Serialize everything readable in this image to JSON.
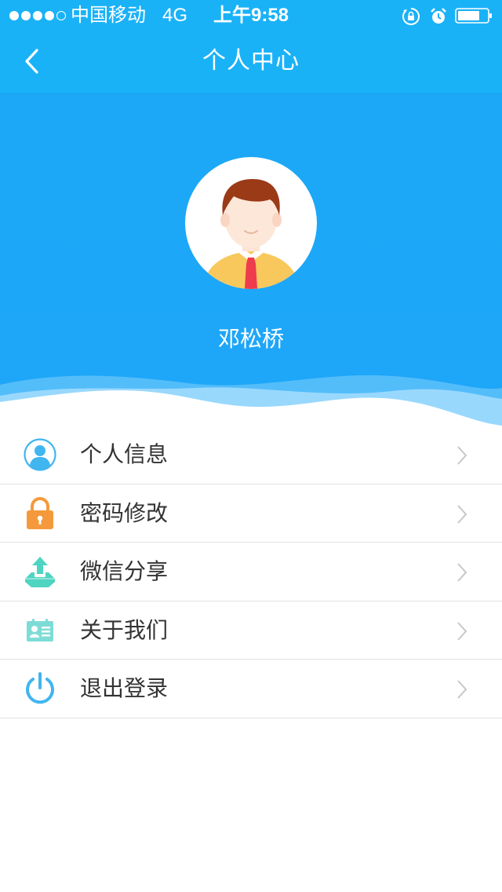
{
  "status_bar": {
    "carrier": "中国移动",
    "network": "4G",
    "time": "上午9:58"
  },
  "nav": {
    "title": "个人中心"
  },
  "profile": {
    "name": "邓松桥"
  },
  "menu": {
    "items": [
      {
        "label": "个人信息",
        "icon": "user-icon"
      },
      {
        "label": "密码修改",
        "icon": "lock-icon"
      },
      {
        "label": "微信分享",
        "icon": "share-icon"
      },
      {
        "label": "关于我们",
        "icon": "id-card-icon"
      },
      {
        "label": "退出登录",
        "icon": "power-icon"
      }
    ]
  },
  "colors": {
    "primary": "#1ab2f7",
    "header_blue": "#1ea6f9",
    "lock_orange": "#f49a3c",
    "share_teal": "#4fd4c1",
    "icon_blue": "#41b5ef"
  }
}
